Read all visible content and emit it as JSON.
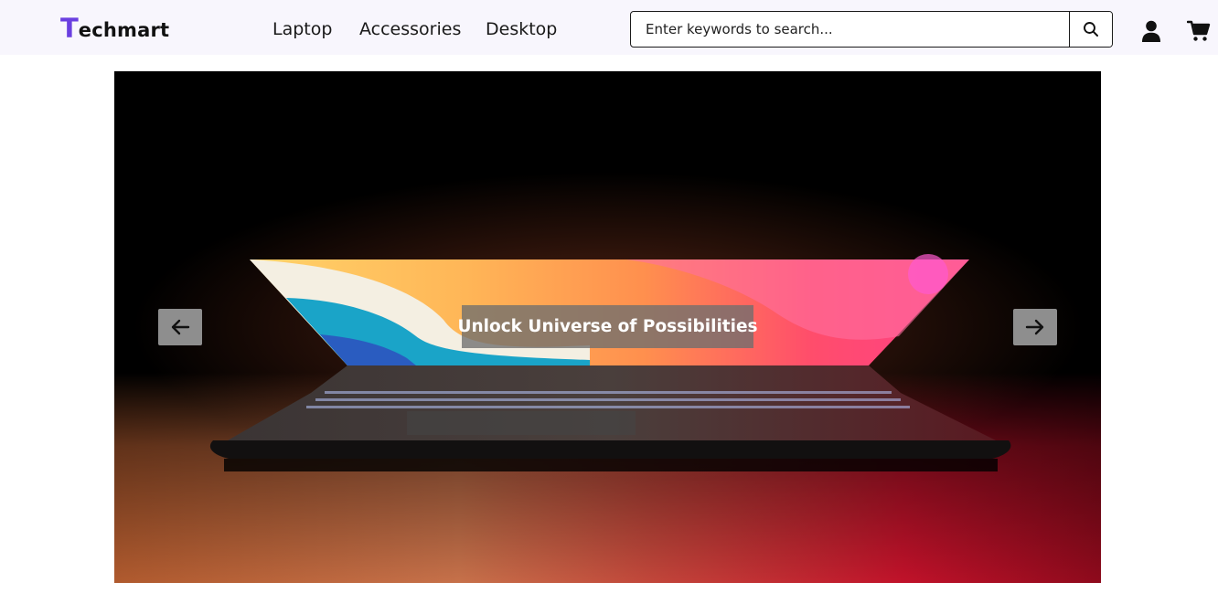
{
  "brand": {
    "first_letter": "T",
    "rest": "echmart",
    "accent_color": "#6a3fe0"
  },
  "nav": {
    "items": [
      {
        "label": "Laptop"
      },
      {
        "label": "Accessories"
      },
      {
        "label": "Desktop"
      }
    ]
  },
  "search": {
    "placeholder": "Enter keywords to search...",
    "value": "",
    "button_icon": "search-icon"
  },
  "header_icons": {
    "account": "user-icon",
    "cart": "cart-icon"
  },
  "hero": {
    "caption": "Unlock Universe of Possibilities",
    "prev_icon": "arrow-left-icon",
    "next_icon": "arrow-right-icon"
  }
}
